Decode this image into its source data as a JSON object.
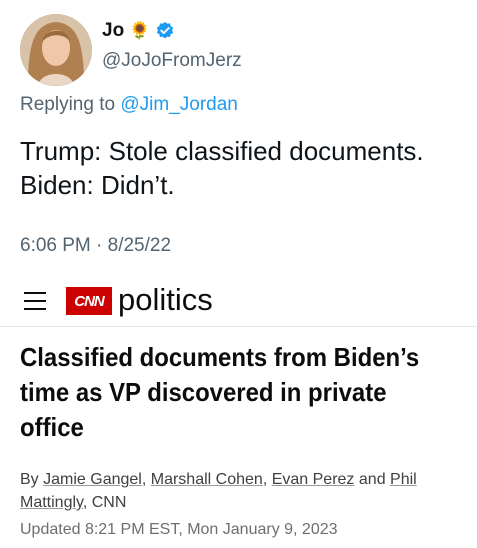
{
  "tweet": {
    "display_name": "Jo",
    "name_emoji": "🌻",
    "handle": "@JoJoFromJerz",
    "replying_prefix": "Replying to",
    "replying_to": "@Jim_Jordan",
    "text_line1": "Trump: Stole classified documents.",
    "text_line2": "Biden: Didn’t.",
    "timestamp": "6:06 PM · 8/25/22",
    "verified_color": "#1d9bf0"
  },
  "article": {
    "logo_text": "CNN",
    "section": "politics",
    "headline": "Classified documents from Biden’s time as VP discovered in private office",
    "byline_prefix": "By",
    "authors": [
      "Jamie Gangel",
      "Marshall Cohen",
      "Evan Perez",
      "Phil Mattingly"
    ],
    "sep1": ",",
    "sep2": ",",
    "sep_and": "and",
    "outlet": ", CNN",
    "updated": "Updated 8:21 PM EST, Mon January 9, 2023",
    "brand_color": "#cc0000"
  }
}
